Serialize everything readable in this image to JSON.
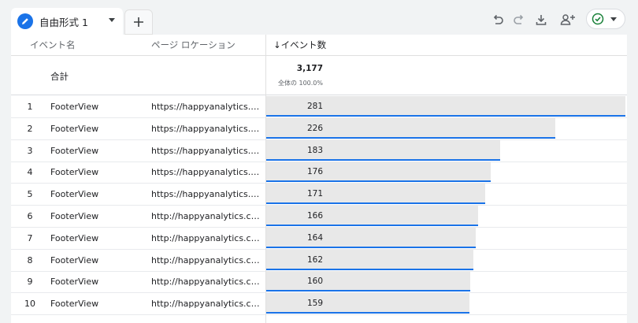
{
  "tab": {
    "label": "自由形式 1",
    "icon": "pencil-icon"
  },
  "toolbar": {
    "icons": [
      "undo-icon",
      "redo-icon",
      "download-icon",
      "share-user-icon",
      "check-circle-icon"
    ],
    "accent": "#1a73e8",
    "status_color": "#188038"
  },
  "table": {
    "headers": {
      "event_name": "イベント名",
      "page_location": "ページ ロケーション",
      "event_count": "↓イベント数"
    },
    "total": {
      "label": "合計",
      "value": "3,177",
      "pct": "全体の 100.0%"
    },
    "rows": [
      {
        "index": "1",
        "event": "FooterView",
        "url": "https://happyanalytics.co.jp/",
        "count": "281",
        "fraction": 1.0
      },
      {
        "index": "2",
        "event": "FooterView",
        "url": "https://happyanalytics.co.jp/",
        "count": "226",
        "fraction": 0.804
      },
      {
        "index": "3",
        "event": "FooterView",
        "url": "https://happyanalytics.co.jp/",
        "count": "183",
        "fraction": 0.651
      },
      {
        "index": "4",
        "event": "FooterView",
        "url": "https://happyanalytics.co.jp/",
        "count": "176",
        "fraction": 0.626
      },
      {
        "index": "5",
        "event": "FooterView",
        "url": "https://happyanalytics.co.jp/",
        "count": "171",
        "fraction": 0.609
      },
      {
        "index": "6",
        "event": "FooterView",
        "url": "http://happyanalytics.co.jp/",
        "count": "166",
        "fraction": 0.591
      },
      {
        "index": "7",
        "event": "FooterView",
        "url": "http://happyanalytics.co.jp/",
        "count": "164",
        "fraction": 0.584
      },
      {
        "index": "8",
        "event": "FooterView",
        "url": "http://happyanalytics.co.jp/",
        "count": "162",
        "fraction": 0.577
      },
      {
        "index": "9",
        "event": "FooterView",
        "url": "http://happyanalytics.co.jp/",
        "count": "160",
        "fraction": 0.569
      },
      {
        "index": "10",
        "event": "FooterView",
        "url": "http://happyanalytics.co.jp/",
        "count": "159",
        "fraction": 0.566
      }
    ]
  }
}
